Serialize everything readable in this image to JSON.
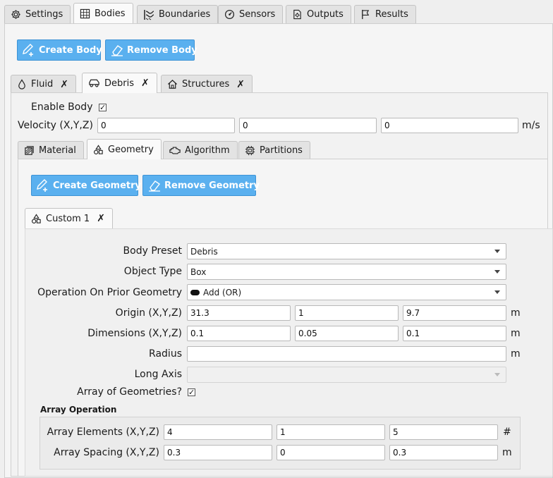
{
  "top_tabs": {
    "settings": "Settings",
    "bodies": "Bodies",
    "boundaries": "Boundaries",
    "sensors": "Sensors",
    "outputs": "Outputs",
    "results": "Results"
  },
  "body_buttons": {
    "create": "Create Body",
    "remove": "Remove Body"
  },
  "body_tabs": {
    "fluid": "Fluid",
    "debris": "Debris",
    "structures": "Structures"
  },
  "body": {
    "enable_label": "Enable Body",
    "enable_checked": "✓",
    "velocity_label": "Velocity (X,Y,Z)",
    "velocity_x": "0",
    "velocity_y": "0",
    "velocity_z": "0",
    "velocity_unit": "m/s"
  },
  "sub_tabs": {
    "material": "Material",
    "geometry": "Geometry",
    "algorithm": "Algorithm",
    "partitions": "Partitions"
  },
  "geometry_buttons": {
    "create": "Create Geometry",
    "remove": "Remove Geometry"
  },
  "geometry_tab": {
    "label": "Custom 1"
  },
  "form": {
    "preset_label": "Body Preset",
    "preset_value": "Debris",
    "object_type_label": "Object Type",
    "object_type_value": "Box",
    "operation_label": "Operation On Prior Geometry",
    "operation_value": "Add (OR)",
    "origin_label": "Origin (X,Y,Z)",
    "origin_x": "31.3",
    "origin_y": "1",
    "origin_z": "9.7",
    "origin_unit": "m",
    "dims_label": "Dimensions (X,Y,Z)",
    "dims_x": "0.1",
    "dims_y": "0.05",
    "dims_z": "0.1",
    "dims_unit": "m",
    "radius_label": "Radius",
    "radius_value": "",
    "radius_unit": "m",
    "long_axis_label": "Long Axis",
    "long_axis_value": "",
    "array_label": "Array of Geometries?",
    "array_checked": "✓"
  },
  "array_op": {
    "title": "Array Operation",
    "elements_label": "Array Elements (X,Y,Z)",
    "elements_x": "4",
    "elements_y": "1",
    "elements_z": "5",
    "elements_unit": "#",
    "spacing_label": "Array Spacing (X,Y,Z)",
    "spacing_x": "0.3",
    "spacing_y": "0",
    "spacing_z": "0.3",
    "spacing_unit": "m"
  }
}
